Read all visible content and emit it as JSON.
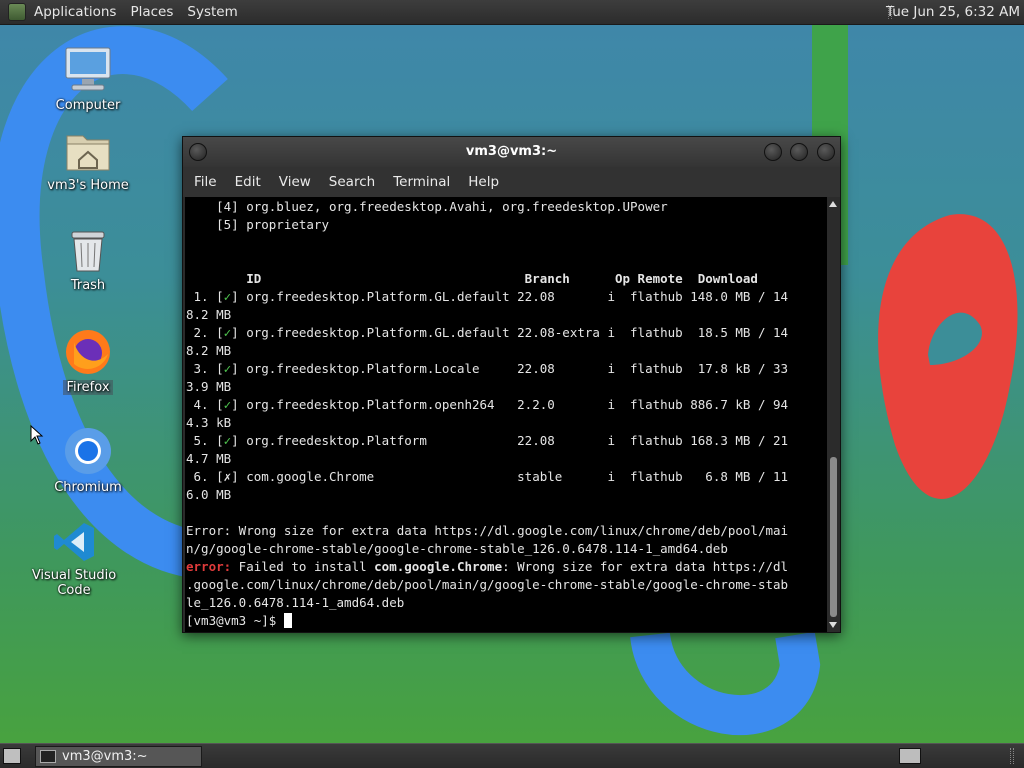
{
  "top_panel": {
    "menus": [
      "Applications",
      "Places",
      "System"
    ],
    "clock": "Tue Jun 25,  6:32 AM"
  },
  "desktop_icons": [
    {
      "label": "Computer",
      "icon": "computer-icon"
    },
    {
      "label": "vm3's Home",
      "icon": "home-folder-icon"
    },
    {
      "label": "Trash",
      "icon": "trash-icon"
    },
    {
      "label": "Firefox",
      "icon": "firefox-icon"
    },
    {
      "label": "Chromium",
      "icon": "chromium-icon"
    },
    {
      "label": "Visual Studio Code",
      "icon": "vscode-icon"
    }
  ],
  "window": {
    "title": "vm3@vm3:~",
    "menu": [
      "File",
      "Edit",
      "View",
      "Search",
      "Terminal",
      "Help"
    ]
  },
  "terminal": {
    "pre_lines": [
      "    [4] org.bluez, org.freedesktop.Avahi, org.freedesktop.UPower",
      "    [5] proprietary"
    ],
    "header": "        ID                                   Branch      Op Remote  Download",
    "rows": [
      {
        "num": " 1. [",
        "mark": "✓",
        "rest": "] org.freedesktop.Platform.GL.default 22.08       i  flathub 148.0 MB / 14",
        "wrap": "8.2 MB"
      },
      {
        "num": " 2. [",
        "mark": "✓",
        "rest": "] org.freedesktop.Platform.GL.default 22.08-extra i  flathub  18.5 MB / 14",
        "wrap": "8.2 MB"
      },
      {
        "num": " 3. [",
        "mark": "✓",
        "rest": "] org.freedesktop.Platform.Locale     22.08       i  flathub  17.8 kB / 33",
        "wrap": "3.9 MB"
      },
      {
        "num": " 4. [",
        "mark": "✓",
        "rest": "] org.freedesktop.Platform.openh264   2.2.0       i  flathub 886.7 kB / 94",
        "wrap": "4.3 kB"
      },
      {
        "num": " 5. [",
        "mark": "✓",
        "rest": "] org.freedesktop.Platform            22.08       i  flathub 168.3 MB / 21",
        "wrap": "4.7 MB"
      },
      {
        "num": " 6. [",
        "mark": "✗",
        "rest": "] com.google.Chrome                   stable      i  flathub   6.8 MB / 11",
        "wrap": "6.0 MB"
      }
    ],
    "error1_line1": "Error: Wrong size for extra data https://dl.google.com/linux/chrome/deb/pool/mai",
    "error1_line2": "n/g/google-chrome-stable/google-chrome-stable_126.0.6478.114-1_amd64.deb",
    "error2_prefix": "error:",
    "error2_mid": " Failed to install ",
    "error2_app": "com.google.Chrome",
    "error2_rest": ": Wrong size for extra data https://dl",
    "error2_line2": ".google.com/linux/chrome/deb/pool/main/g/google-chrome-stable/google-chrome-stab",
    "error2_line3": "le_126.0.6478.114-1_amd64.deb",
    "prompt": "[vm3@vm3 ~]$ "
  },
  "taskbar": {
    "task_label": "vm3@vm3:~"
  },
  "colors": {
    "ok_mark": "#4ec24e",
    "error": "#e03b3b"
  }
}
